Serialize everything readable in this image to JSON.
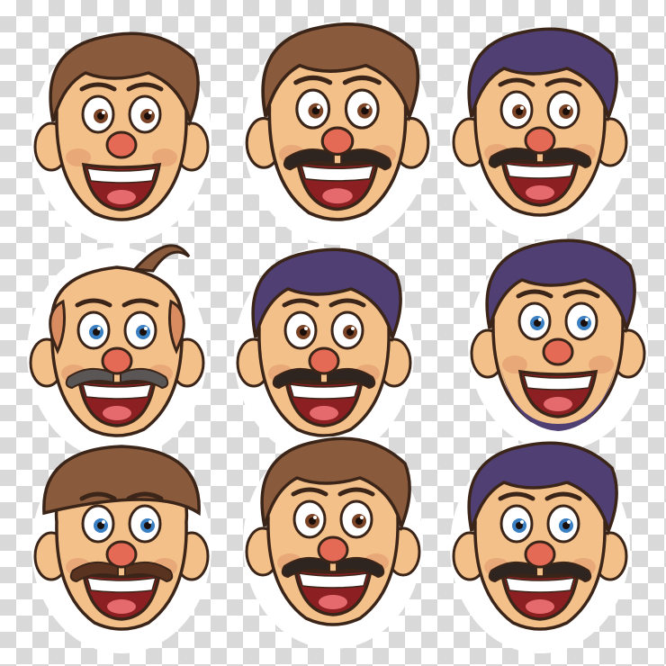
{
  "scene": {
    "background": "transparent-checkerboard",
    "grid": {
      "rows": 3,
      "columns": 3
    }
  },
  "faces": [
    {
      "name": "face-brown-hair-grin",
      "hair": "brown-quiff",
      "mustache": "none",
      "eyes": "brown",
      "expression": "toothy-grin"
    },
    {
      "name": "face-brown-hair-mustache",
      "hair": "brown-swept",
      "mustache": "thin-dark",
      "eyes": "brown",
      "expression": "big-smile"
    },
    {
      "name": "face-purple-hair-mustache",
      "hair": "purple-pompadour",
      "mustache": "curly-dark",
      "eyes": "brown",
      "expression": "big-smile"
    },
    {
      "name": "face-bald-gray-mustache",
      "hair": "bald-tuft",
      "mustache": "gray-walrus",
      "eyes": "blue",
      "expression": "smile"
    },
    {
      "name": "face-dark-hair-goatee",
      "hair": "dark-wavy",
      "mustache": "dark",
      "eyes": "brown",
      "expression": "laugh"
    },
    {
      "name": "face-purple-hair-beard",
      "hair": "purple-spiky",
      "mustache": "none",
      "eyes": "blue",
      "expression": "grin"
    },
    {
      "name": "face-cap-brown-mustache",
      "hair": "brown-flat-cap",
      "mustache": "brown-bushy",
      "eyes": "blue",
      "expression": "laugh"
    },
    {
      "name": "face-quiff-red-nose",
      "hair": "brown-quiff",
      "mustache": "dark-thin",
      "eyes": "brown",
      "expression": "laugh"
    },
    {
      "name": "face-purple-hair-curly-mustache",
      "hair": "purple-side-part",
      "mustache": "curly-dark",
      "eyes": "blue",
      "expression": "open-smile"
    }
  ],
  "colors": {
    "skin": "#f4c08a",
    "skin_shadow": "#d98c5f",
    "outline": "#3b2418",
    "brown_hair": "#8a5a3c",
    "purple_hair": "#4f3f73",
    "nose": "#e46a55",
    "mouth": "#8c1f22",
    "teeth": "#ffffff",
    "gray_mustache": "#5a5656",
    "blue_eye": "#3a7fc2",
    "brown_eye": "#7a4326"
  }
}
